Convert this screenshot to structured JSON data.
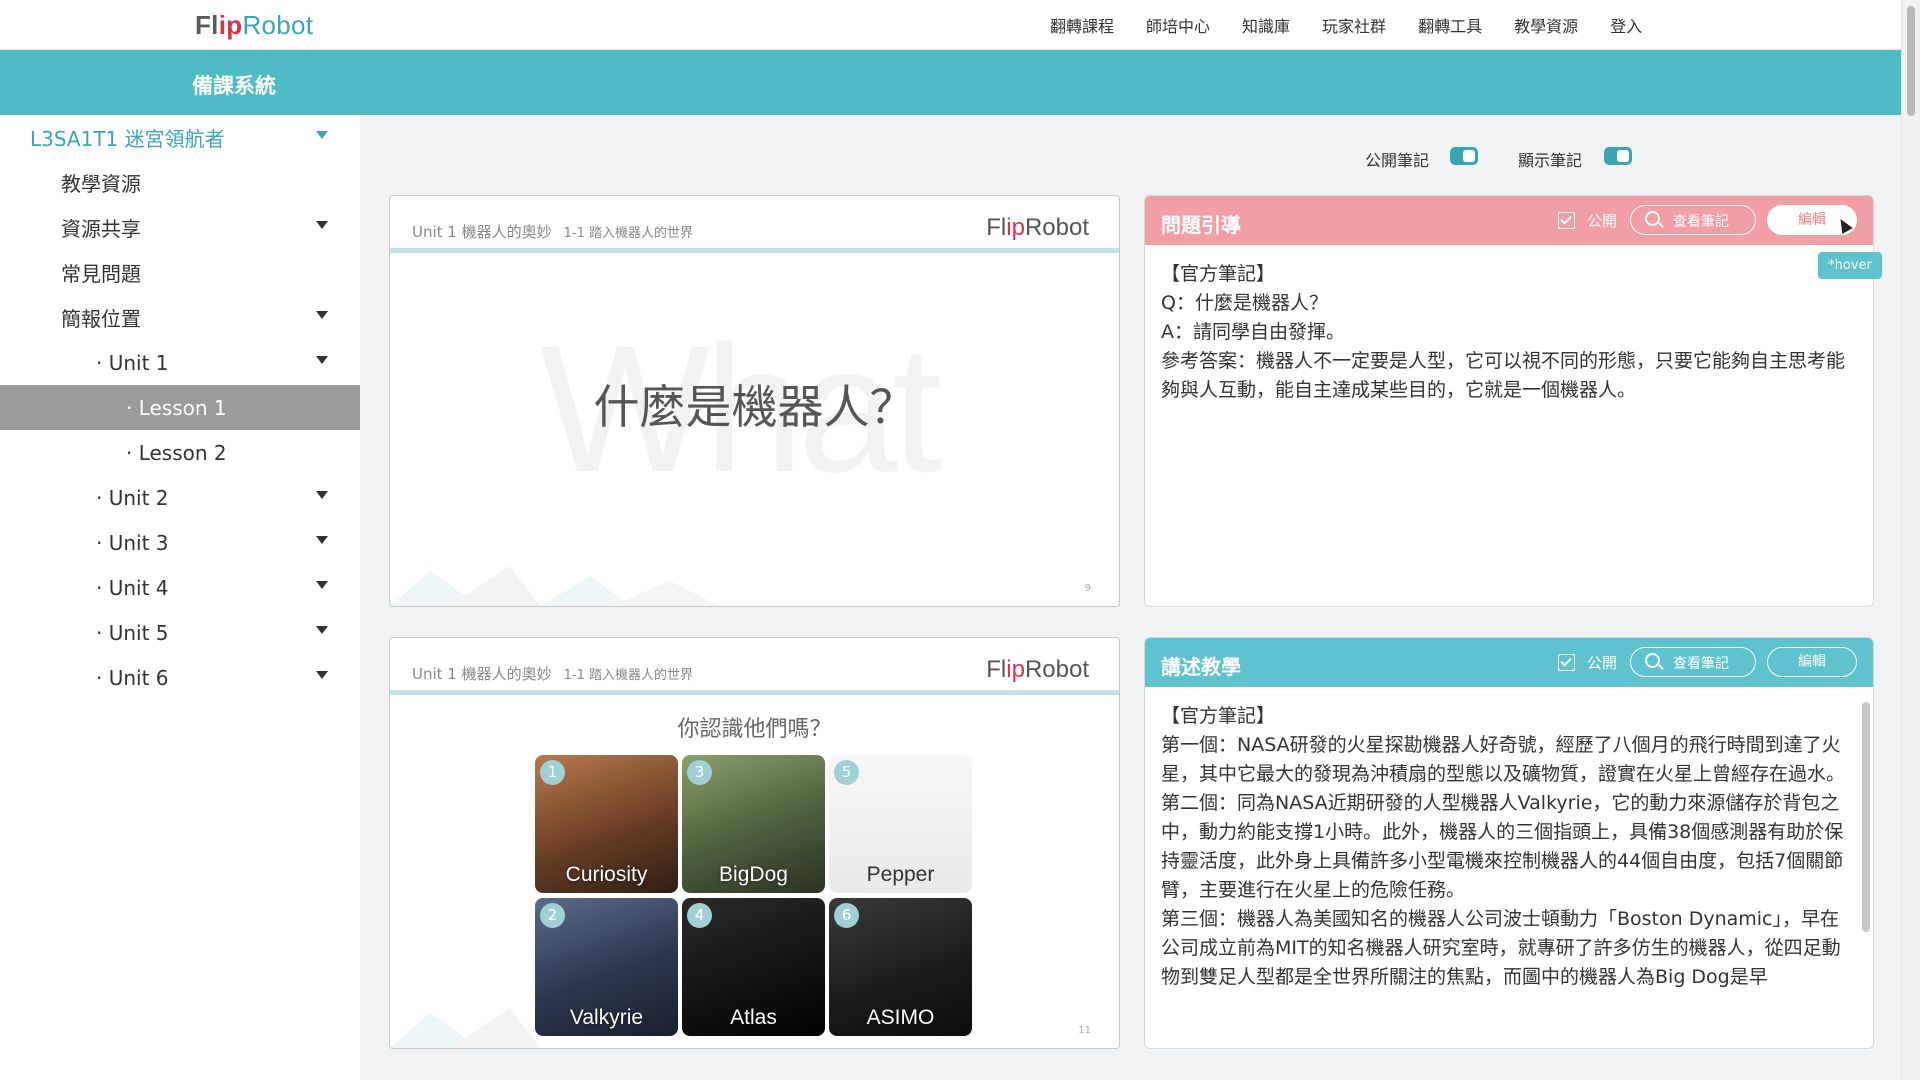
{
  "header": {
    "logo": {
      "part1": "Fl",
      "part2": "ip",
      "part3": "Robot"
    },
    "nav": [
      "翻轉課程",
      "師培中心",
      "知識庫",
      "玩家社群",
      "翻轉工具",
      "教學資源",
      "登入"
    ]
  },
  "band": {
    "title": "備課系統"
  },
  "sidebar": {
    "items": [
      {
        "label": "L3SA1T1 迷宮領航者",
        "expandable": true
      },
      {
        "label": "教學資源",
        "expandable": false
      },
      {
        "label": "資源共享",
        "expandable": true
      },
      {
        "label": "常見問題",
        "expandable": false
      },
      {
        "label": "簡報位置",
        "expandable": true
      },
      {
        "label": "· Unit 1",
        "expandable": true
      },
      {
        "label": "· Lesson 1",
        "expandable": false,
        "active": true
      },
      {
        "label": "· Lesson 2",
        "expandable": false
      },
      {
        "label": "· Unit 2",
        "expandable": true
      },
      {
        "label": "· Unit 3",
        "expandable": true
      },
      {
        "label": "· Unit 4",
        "expandable": true
      },
      {
        "label": "· Unit 5",
        "expandable": true
      },
      {
        "label": "· Unit 6",
        "expandable": true
      }
    ]
  },
  "toggles": {
    "public_notes": "公開筆記",
    "show_notes": "顯示筆記"
  },
  "slides": [
    {
      "unit": "Unit 1 機器人的奧妙",
      "sub": "1-1 踏入機器人的世界",
      "logo": {
        "part1": "Fl",
        "part2": "ip",
        "part3": "Robot"
      },
      "ghost": "What",
      "question": "什麼是機器人？",
      "page": "9"
    },
    {
      "unit": "Unit 1 機器人的奧妙",
      "sub": "1-1 踏入機器人的世界",
      "logo": {
        "part1": "Fl",
        "part2": "ip",
        "part3": "Robot"
      },
      "question": "你認識他們嗎？",
      "tiles": [
        {
          "num": "1",
          "name": "Curiosity"
        },
        {
          "num": "3",
          "name": "BigDog"
        },
        {
          "num": "5",
          "name": "Pepper"
        },
        {
          "num": "2",
          "name": "Valkyrie"
        },
        {
          "num": "4",
          "name": "Atlas"
        },
        {
          "num": "6",
          "name": "ASIMO"
        }
      ],
      "page": "11"
    }
  ],
  "panels": [
    {
      "title": "問題引導",
      "color": "#f19ea4",
      "public_label": "公開",
      "view_label": "查看筆記",
      "edit_label": "編輯",
      "body": "【官方筆記】\nQ：什麼是機器人？\nA：請同學自由發揮。\n參考答案：機器人不一定要是人型，它可以視不同的形態，只要它能夠自主思考能夠與人互動，能自主達成某些目的，它就是一個機器人。"
    },
    {
      "title": "講述教學",
      "color": "#5ec3ce",
      "public_label": "公開",
      "view_label": "查看筆記",
      "edit_label": "編輯",
      "body": "【官方筆記】\n第一個：NASA研發的火星探勘機器人好奇號，經歷了八個月的飛行時間到達了火星，其中它最大的發現為沖積扇的型態以及礦物質，證實在火星上曾經存在過水。\n第二個：同為NASA近期研發的人型機器人Valkyrie，它的動力來源儲存於背包之中，動力約能支撐1小時。此外，機器人的三個指頭上，具備38個感測器有助於保持靈活度，此外身上具備許多小型電機來控制機器人的44個自由度，包括7個關節臂，主要進行在火星上的危險任務。\n第三個：機器人為美國知名的機器人公司波士頓動力「Boston Dynamic」，早在公司成立前為MIT的知名機器人研究室時，就專研了許多仿生的機器人，從四足動物到雙足人型都是全世界所關注的焦點，而圖中的機器人為Big Dog是早"
    }
  ],
  "hover_tag": "*hover"
}
